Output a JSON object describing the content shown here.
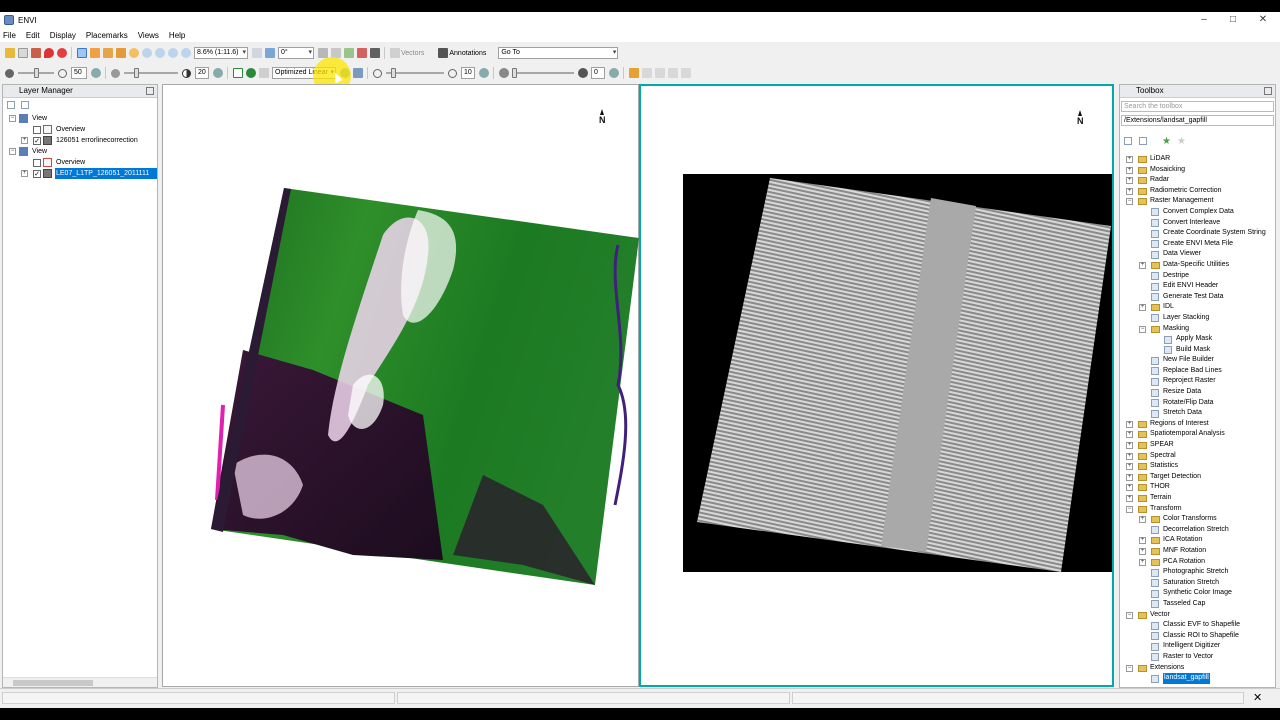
{
  "window": {
    "title": "ENVI",
    "min": "–",
    "max": "□",
    "close": "✕"
  },
  "menu": [
    "File",
    "Edit",
    "Display",
    "Placemarks",
    "Views",
    "Help"
  ],
  "toolbar": {
    "zoom_value": "8.6% (1:11.6)",
    "rotation_value": "0°",
    "vectors_label": "Vectors",
    "annotations_label": "Annotations",
    "goto_value": "Go To",
    "brightness_value": "50",
    "contrast_value": "20",
    "stretch_value": "Optimized Linear",
    "sharpen_value": "10",
    "transparency_value": "0",
    "brightness_level": 0.5,
    "contrast_level": 0.2,
    "sharpen_level": 0.1,
    "transparency_level": 0.0
  },
  "layer_manager": {
    "title": "Layer Manager",
    "items": [
      {
        "label": "View",
        "level": 0,
        "type": "view"
      },
      {
        "label": "Overview",
        "level": 1,
        "type": "overview"
      },
      {
        "label": "126051 errorlinecorrection",
        "level": 1,
        "type": "raster",
        "checked": true
      },
      {
        "label": "View",
        "level": 0,
        "type": "view"
      },
      {
        "label": "Overview",
        "level": 1,
        "type": "overview"
      },
      {
        "label": "LE07_L1TP_126051_2011111",
        "level": 1,
        "type": "raster",
        "checked": true,
        "selected": true
      }
    ]
  },
  "views": {
    "north_label": "N"
  },
  "toolbox": {
    "title": "Toolbox",
    "search_placeholder": "Search the toolbox",
    "path": "/Extensions/landsat_gapfill",
    "items": [
      {
        "label": "LiDAR",
        "level": 0,
        "type": "folder"
      },
      {
        "label": "Mosaicking",
        "level": 0,
        "type": "folder"
      },
      {
        "label": "Radar",
        "level": 0,
        "type": "folder"
      },
      {
        "label": "Radiometric Correction",
        "level": 0,
        "type": "folder"
      },
      {
        "label": "Raster Management",
        "level": 0,
        "type": "folder",
        "open": true
      },
      {
        "label": "Convert Complex Data",
        "level": 1,
        "type": "tool"
      },
      {
        "label": "Convert Interleave",
        "level": 1,
        "type": "tool"
      },
      {
        "label": "Create Coordinate System String",
        "level": 1,
        "type": "tool"
      },
      {
        "label": "Create ENVI Meta File",
        "level": 1,
        "type": "tool"
      },
      {
        "label": "Data Viewer",
        "level": 1,
        "type": "tool"
      },
      {
        "label": "Data-Specific Utilities",
        "level": 1,
        "type": "folder"
      },
      {
        "label": "Destripe",
        "level": 1,
        "type": "tool"
      },
      {
        "label": "Edit ENVI Header",
        "level": 1,
        "type": "tool"
      },
      {
        "label": "Generate Test Data",
        "level": 1,
        "type": "tool"
      },
      {
        "label": "IDL",
        "level": 1,
        "type": "folder"
      },
      {
        "label": "Layer Stacking",
        "level": 1,
        "type": "tool"
      },
      {
        "label": "Masking",
        "level": 1,
        "type": "folder",
        "open": true
      },
      {
        "label": "Apply Mask",
        "level": 2,
        "type": "tool"
      },
      {
        "label": "Build Mask",
        "level": 2,
        "type": "tool"
      },
      {
        "label": "New File Builder",
        "level": 1,
        "type": "tool"
      },
      {
        "label": "Replace Bad Lines",
        "level": 1,
        "type": "tool"
      },
      {
        "label": "Reproject Raster",
        "level": 1,
        "type": "tool"
      },
      {
        "label": "Resize Data",
        "level": 1,
        "type": "tool"
      },
      {
        "label": "Rotate/Flip Data",
        "level": 1,
        "type": "tool"
      },
      {
        "label": "Stretch Data",
        "level": 1,
        "type": "tool"
      },
      {
        "label": "Regions of Interest",
        "level": 0,
        "type": "folder"
      },
      {
        "label": "Spatiotemporal Analysis",
        "level": 0,
        "type": "folder"
      },
      {
        "label": "SPEAR",
        "level": 0,
        "type": "folder"
      },
      {
        "label": "Spectral",
        "level": 0,
        "type": "folder"
      },
      {
        "label": "Statistics",
        "level": 0,
        "type": "folder"
      },
      {
        "label": "Target Detection",
        "level": 0,
        "type": "folder"
      },
      {
        "label": "THOR",
        "level": 0,
        "type": "folder"
      },
      {
        "label": "Terrain",
        "level": 0,
        "type": "folder"
      },
      {
        "label": "Transform",
        "level": 0,
        "type": "folder",
        "open": true
      },
      {
        "label": "Color Transforms",
        "level": 1,
        "type": "folder"
      },
      {
        "label": "Decorrelation Stretch",
        "level": 1,
        "type": "tool"
      },
      {
        "label": "ICA Rotation",
        "level": 1,
        "type": "folder"
      },
      {
        "label": "MNF Rotation",
        "level": 1,
        "type": "folder"
      },
      {
        "label": "PCA Rotation",
        "level": 1,
        "type": "folder"
      },
      {
        "label": "Photographic Stretch",
        "level": 1,
        "type": "tool"
      },
      {
        "label": "Saturation Stretch",
        "level": 1,
        "type": "tool"
      },
      {
        "label": "Synthetic Color Image",
        "level": 1,
        "type": "tool"
      },
      {
        "label": "Tasseled Cap",
        "level": 1,
        "type": "tool"
      },
      {
        "label": "Vector",
        "level": 0,
        "type": "folder",
        "open": true
      },
      {
        "label": "Classic EVF to Shapefile",
        "level": 1,
        "type": "tool"
      },
      {
        "label": "Classic ROI to Shapefile",
        "level": 1,
        "type": "tool"
      },
      {
        "label": "Intelligent Digitizer",
        "level": 1,
        "type": "tool"
      },
      {
        "label": "Raster to Vector",
        "level": 1,
        "type": "tool"
      },
      {
        "label": "Extensions",
        "level": 0,
        "type": "folder",
        "open": true
      },
      {
        "label": "landsat_gapfill",
        "level": 1,
        "type": "tool",
        "selected": true
      }
    ]
  },
  "colors": {
    "accent": "#00aaa6",
    "selection": "#0078d7"
  }
}
